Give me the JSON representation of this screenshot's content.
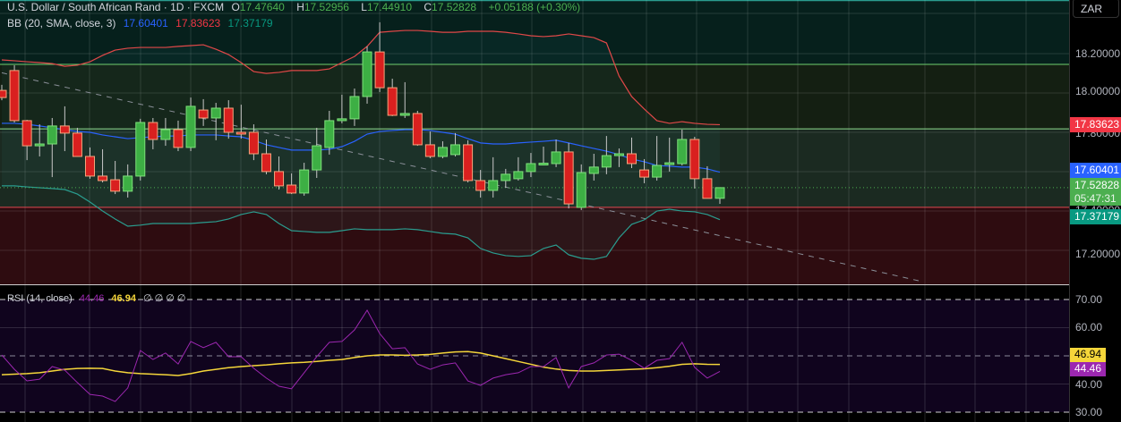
{
  "header": {
    "symbol": "U.S. Dollar / South African Rand · 1D · FXCM",
    "open_label": "O",
    "open": "17.47640",
    "high_label": "H",
    "high": "17.52956",
    "low_label": "L",
    "low": "17.44910",
    "close_label": "C",
    "close": "17.52828",
    "change": "+0.05188 (+0.30%)"
  },
  "bb_legend": {
    "label": "BB (20, SMA, close, 3)",
    "basis": "17.60401",
    "upper": "17.83623",
    "lower": "17.37179"
  },
  "rsi_legend": {
    "label": "RSI (14, close)",
    "rsi": "44.46",
    "ma": "46.94",
    "extras": "∅ ∅ ∅ ∅"
  },
  "axis": {
    "currency": "ZAR",
    "price_ticks": [
      "18.20000",
      "18.00000",
      "17.80000",
      "17.40000",
      "17.20000"
    ],
    "rsi_ticks": [
      "70.00",
      "60.00",
      "40.00",
      "30.00"
    ],
    "upper_tag": "17.83623",
    "basis_tag": "17.60401",
    "last_tag": "17.52828",
    "countdown": "05:47:31",
    "lower_tag": "17.37179",
    "rsi_ma_tag": "46.94",
    "rsi_tag": "44.46"
  },
  "colors": {
    "up": "#3daf44",
    "down": "#d9201f",
    "basis": "#2962ff",
    "upper": "#e04848",
    "lower": "#2a9d8f",
    "rsi": "#9c27b0",
    "rsi_ma": "#f5d63a"
  },
  "chart_data": {
    "type": "candlestick",
    "title": "U.S. Dollar / South African Rand · 1D · FXCM",
    "ylim": [
      17.1,
      18.45
    ],
    "levels": {
      "resistance_high": 18.131,
      "resistance_low": 17.816,
      "support": 17.432
    },
    "trendline": {
      "from": [
        0,
        18.09
      ],
      "to": [
        73,
        17.07
      ]
    },
    "candles_ohlc": [
      [
        18.004,
        18.031,
        17.956,
        17.969
      ],
      [
        18.101,
        18.127,
        17.847,
        17.856
      ],
      [
        17.856,
        17.86,
        17.663,
        17.733
      ],
      [
        17.733,
        17.838,
        17.681,
        17.742
      ],
      [
        17.742,
        17.869,
        17.58,
        17.83
      ],
      [
        17.83,
        17.926,
        17.707,
        17.795
      ],
      [
        17.795,
        17.821,
        17.681,
        17.681
      ],
      [
        17.681,
        17.725,
        17.572,
        17.585
      ],
      [
        17.585,
        17.716,
        17.554,
        17.563
      ],
      [
        17.567,
        17.659,
        17.497,
        17.511
      ],
      [
        17.511,
        17.642,
        17.48,
        17.585
      ],
      [
        17.585,
        17.865,
        17.563,
        17.847
      ],
      [
        17.847,
        17.869,
        17.716,
        17.764
      ],
      [
        17.764,
        17.869,
        17.733,
        17.812
      ],
      [
        17.812,
        17.856,
        17.707,
        17.725
      ],
      [
        17.725,
        17.969,
        17.707,
        17.926
      ],
      [
        17.908,
        17.961,
        17.83,
        17.869
      ],
      [
        17.869,
        17.943,
        17.76,
        17.917
      ],
      [
        17.917,
        17.956,
        17.768,
        17.799
      ],
      [
        17.799,
        17.934,
        17.768,
        17.797
      ],
      [
        17.799,
        17.838,
        17.663,
        17.694
      ],
      [
        17.694,
        17.764,
        17.594,
        17.607
      ],
      [
        17.607,
        17.681,
        17.519,
        17.537
      ],
      [
        17.541,
        17.598,
        17.497,
        17.502
      ],
      [
        17.502,
        17.65,
        17.489,
        17.615
      ],
      [
        17.615,
        17.821,
        17.576,
        17.733
      ],
      [
        17.725,
        17.904,
        17.69,
        17.856
      ],
      [
        17.856,
        17.983,
        17.843,
        17.865
      ],
      [
        17.865,
        18.013,
        17.83,
        17.974
      ],
      [
        17.974,
        18.219,
        17.939,
        18.192
      ],
      [
        18.192,
        18.337,
        17.996,
        18.017
      ],
      [
        18.017,
        18.061,
        17.878,
        17.882
      ],
      [
        17.882,
        18.044,
        17.869,
        17.891
      ],
      [
        17.891,
        17.904,
        17.733,
        17.738
      ],
      [
        17.738,
        17.803,
        17.672,
        17.681
      ],
      [
        17.681,
        17.755,
        17.672,
        17.725
      ],
      [
        17.69,
        17.795,
        17.681,
        17.738
      ],
      [
        17.738,
        17.76,
        17.554,
        17.563
      ],
      [
        17.563,
        17.615,
        17.48,
        17.515
      ],
      [
        17.515,
        17.677,
        17.48,
        17.563
      ],
      [
        17.563,
        17.62,
        17.528,
        17.594
      ],
      [
        17.572,
        17.677,
        17.563,
        17.607
      ],
      [
        17.607,
        17.698,
        17.58,
        17.646
      ],
      [
        17.646,
        17.729,
        17.637,
        17.648
      ],
      [
        17.646,
        17.764,
        17.629,
        17.703
      ],
      [
        17.703,
        17.747,
        17.427,
        17.449
      ],
      [
        17.432,
        17.642,
        17.419,
        17.602
      ],
      [
        17.598,
        17.694,
        17.563,
        17.629
      ],
      [
        17.629,
        17.781,
        17.594,
        17.685
      ],
      [
        17.685,
        17.72,
        17.629,
        17.694
      ],
      [
        17.694,
        17.773,
        17.624,
        17.646
      ],
      [
        17.615,
        17.668,
        17.55,
        17.58
      ],
      [
        17.58,
        17.781,
        17.563,
        17.637
      ],
      [
        17.642,
        17.773,
        17.607,
        17.65
      ],
      [
        17.646,
        17.812,
        17.637,
        17.764
      ],
      [
        17.764,
        17.777,
        17.524,
        17.572
      ],
      [
        17.572,
        17.633,
        17.48,
        17.476
      ],
      [
        17.4764,
        17.52956,
        17.4491,
        17.52828
      ]
    ],
    "bb_upper": [
      18.153,
      18.149,
      18.144,
      18.14,
      18.135,
      18.122,
      18.127,
      18.144,
      18.175,
      18.201,
      18.21,
      18.214,
      18.214,
      18.214,
      18.219,
      18.223,
      18.227,
      18.205,
      18.179,
      18.14,
      18.096,
      18.087,
      18.092,
      18.101,
      18.101,
      18.101,
      18.109,
      18.14,
      18.17,
      18.219,
      18.288,
      18.293,
      18.297,
      18.297,
      18.293,
      18.288,
      18.288,
      18.293,
      18.293,
      18.293,
      18.288,
      18.28,
      18.271,
      18.267,
      18.271,
      18.28,
      18.271,
      18.262,
      18.236,
      18.074,
      17.974,
      17.913,
      17.856,
      17.843,
      17.851,
      17.843,
      17.838,
      17.83623
    ],
    "bb_basis": [
      17.843,
      17.843,
      17.838,
      17.83,
      17.821,
      17.812,
      17.803,
      17.799,
      17.786,
      17.777,
      17.768,
      17.773,
      17.777,
      17.781,
      17.781,
      17.786,
      17.786,
      17.786,
      17.781,
      17.777,
      17.76,
      17.738,
      17.725,
      17.712,
      17.712,
      17.712,
      17.716,
      17.729,
      17.755,
      17.79,
      17.803,
      17.808,
      17.812,
      17.812,
      17.808,
      17.799,
      17.79,
      17.768,
      17.747,
      17.742,
      17.742,
      17.747,
      17.751,
      17.755,
      17.76,
      17.747,
      17.733,
      17.72,
      17.707,
      17.69,
      17.668,
      17.655,
      17.637,
      17.633,
      17.629,
      17.629,
      17.62,
      17.60401
    ],
    "bb_lower": [
      17.537,
      17.537,
      17.532,
      17.528,
      17.524,
      17.519,
      17.497,
      17.458,
      17.414,
      17.375,
      17.34,
      17.345,
      17.353,
      17.353,
      17.353,
      17.353,
      17.358,
      17.362,
      17.375,
      17.397,
      17.41,
      17.397,
      17.353,
      17.318,
      17.314,
      17.31,
      17.31,
      17.318,
      17.327,
      17.323,
      17.323,
      17.323,
      17.327,
      17.323,
      17.314,
      17.305,
      17.301,
      17.283,
      17.231,
      17.209,
      17.196,
      17.192,
      17.196,
      17.231,
      17.248,
      17.2,
      17.183,
      17.178,
      17.192,
      17.283,
      17.349,
      17.371,
      17.414,
      17.423,
      17.414,
      17.41,
      17.397,
      17.37179
    ],
    "rsi": [
      50.3,
      45.2,
      41.1,
      41.7,
      46.2,
      44.9,
      40.5,
      36.3,
      35.7,
      33.8,
      38.6,
      51.9,
      48.7,
      51.0,
      47.1,
      55.1,
      52.9,
      54.8,
      49.7,
      49.7,
      45.6,
      42.1,
      39.2,
      38.3,
      44.0,
      49.7,
      54.8,
      55.1,
      59.2,
      66.2,
      57.9,
      52.5,
      52.9,
      47.1,
      45.2,
      46.8,
      47.5,
      41.1,
      39.5,
      42.1,
      43.3,
      44.0,
      46.2,
      46.2,
      49.4,
      38.6,
      46.2,
      47.5,
      50.3,
      50.6,
      48.4,
      45.6,
      48.4,
      49.0,
      54.8,
      45.9,
      42.1,
      44.46
    ],
    "rsi_ma": [
      43.3,
      43.5,
      43.7,
      44.0,
      44.6,
      45.2,
      45.5,
      45.6,
      45.5,
      44.6,
      44.0,
      43.7,
      43.5,
      43.3,
      43.0,
      43.7,
      44.6,
      45.2,
      45.8,
      46.2,
      46.5,
      46.8,
      47.2,
      47.5,
      47.7,
      48.0,
      48.4,
      48.7,
      49.4,
      50.0,
      50.3,
      50.3,
      50.2,
      50.3,
      50.5,
      51.0,
      51.4,
      51.5,
      51.0,
      50.0,
      49.0,
      48.0,
      47.0,
      46.0,
      45.3,
      44.8,
      44.6,
      44.6,
      44.8,
      45.0,
      45.2,
      45.4,
      45.8,
      46.3,
      47.0,
      47.2,
      47.0,
      46.94
    ],
    "rsi_levels": [
      70,
      50,
      30
    ],
    "rsi_ylim": [
      25,
      75
    ]
  }
}
